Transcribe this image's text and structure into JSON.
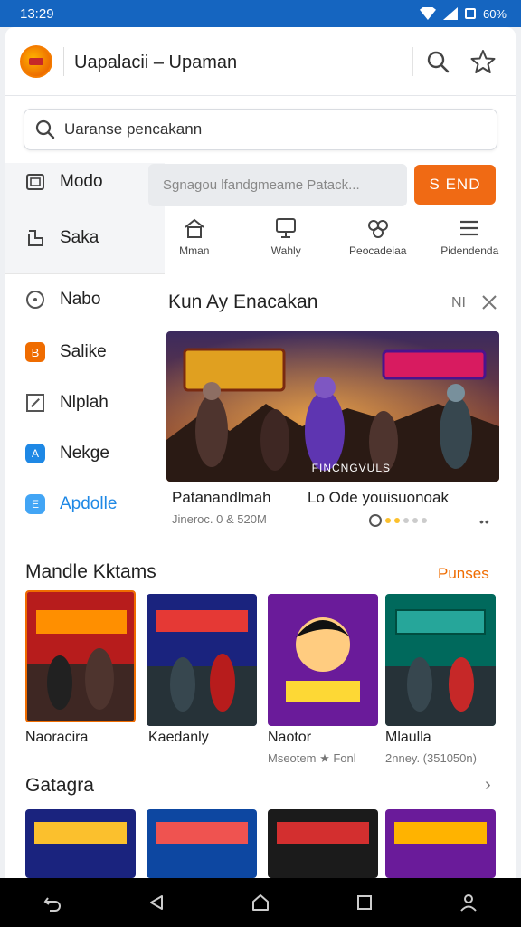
{
  "status": {
    "time": "13:29",
    "battery": "60%"
  },
  "header": {
    "title": "Uapalacii – Upaman"
  },
  "search": {
    "placeholder": "Uaranse pencakann"
  },
  "sidebar": {
    "items": [
      {
        "label": "Modo",
        "icon": "monitor-icon"
      },
      {
        "label": "Saka",
        "icon": "square-bracket-icon"
      },
      {
        "label": "Nabo",
        "icon": "circle-icon"
      },
      {
        "label": "Salike",
        "icon": "orange-box-icon"
      },
      {
        "label": "Nlplah",
        "icon": "square-diagonal-icon"
      },
      {
        "label": "Nekge",
        "icon": "blue-box-icon"
      },
      {
        "label": "Apdolle",
        "icon": "blue-light-box-icon"
      }
    ]
  },
  "filter": {
    "placeholder": "Sgnagou lfandgmeame Patack...",
    "button": "S END"
  },
  "categories": [
    {
      "label": "Mman",
      "icon": "house-icon"
    },
    {
      "label": "Wahly",
      "icon": "monitor-stand-icon"
    },
    {
      "label": "Peocadeiaa",
      "icon": "controller-icon"
    },
    {
      "label": "Pidendenda",
      "icon": "menu-icon"
    }
  ],
  "featured": {
    "title": "Kun Ay Enacakan",
    "badge": "NI",
    "banner_caption": "FINCNGVULS",
    "game1_title": "Patanandlmah",
    "game1_meta": "Jineroc. 0 & 520M",
    "game2_title": "Lo Ode youisuonoak",
    "rating": 2
  },
  "section1": {
    "title": "Mandle Kktams",
    "link": "Punses"
  },
  "tiles": [
    {
      "name": "Naoracira",
      "meta": ""
    },
    {
      "name": "Kaedanly",
      "meta": ""
    },
    {
      "name": "Naotor",
      "meta": "Mseotem ★ Fonl"
    },
    {
      "name": "Mlaulla",
      "meta": "2nney. (351050n)"
    }
  ],
  "section2": {
    "title": "Gatagra"
  },
  "colors": {
    "accent": "#f06a14",
    "blue": "#1565c0"
  }
}
